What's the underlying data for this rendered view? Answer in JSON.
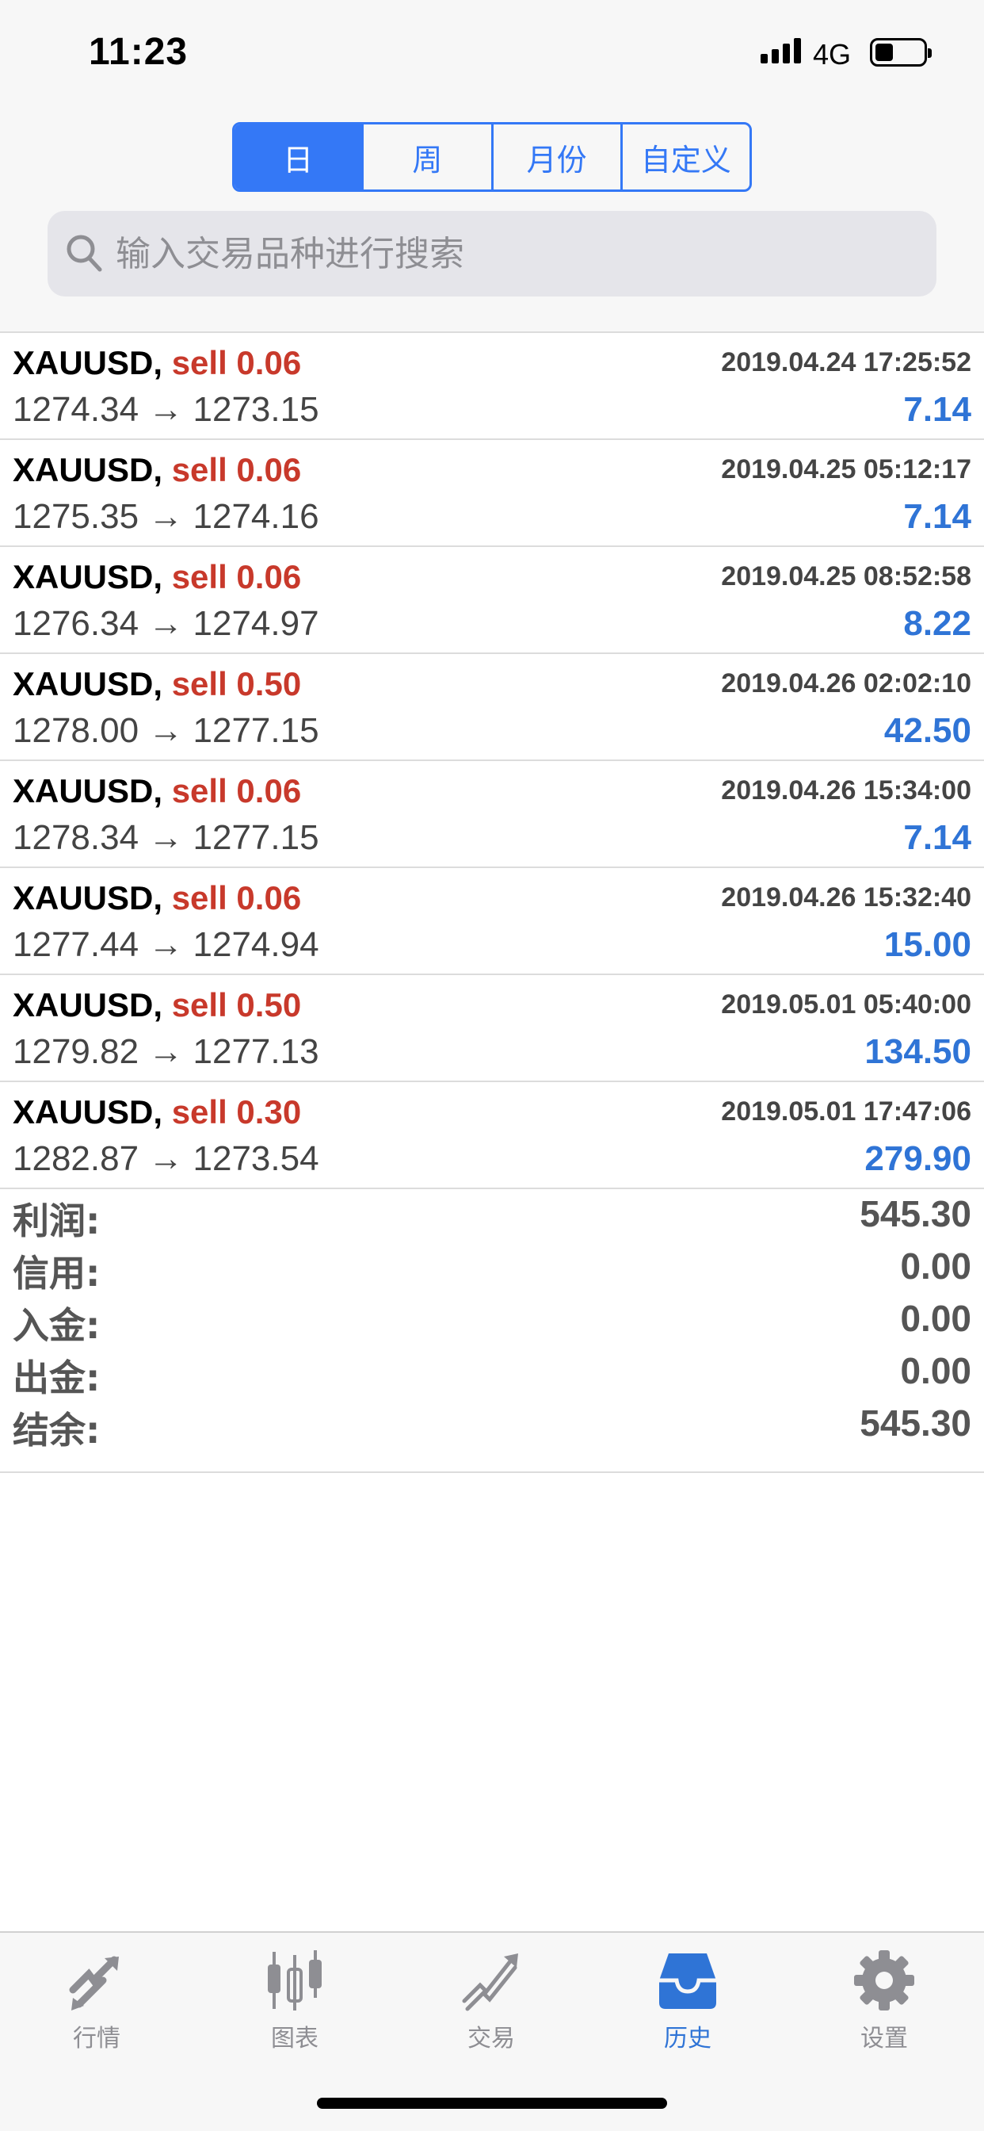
{
  "status": {
    "time": "11:23",
    "network": "4G"
  },
  "segments": [
    {
      "label": "日",
      "active": true
    },
    {
      "label": "周",
      "active": false
    },
    {
      "label": "月份",
      "active": false
    },
    {
      "label": "自定义",
      "active": false
    }
  ],
  "search": {
    "placeholder": "输入交易品种进行搜索"
  },
  "trades": [
    {
      "symbol": "XAUUSD,",
      "side": "sell 0.06",
      "time": "2019.04.24 17:25:52",
      "prices": "1274.34 → 1273.15",
      "profit": "7.14"
    },
    {
      "symbol": "XAUUSD,",
      "side": "sell 0.06",
      "time": "2019.04.25 05:12:17",
      "prices": "1275.35 → 1274.16",
      "profit": "7.14"
    },
    {
      "symbol": "XAUUSD,",
      "side": "sell 0.06",
      "time": "2019.04.25 08:52:58",
      "prices": "1276.34 → 1274.97",
      "profit": "8.22"
    },
    {
      "symbol": "XAUUSD,",
      "side": "sell 0.50",
      "time": "2019.04.26 02:02:10",
      "prices": "1278.00 → 1277.15",
      "profit": "42.50"
    },
    {
      "symbol": "XAUUSD,",
      "side": "sell 0.06",
      "time": "2019.04.26 15:34:00",
      "prices": "1278.34 → 1277.15",
      "profit": "7.14"
    },
    {
      "symbol": "XAUUSD,",
      "side": "sell 0.06",
      "time": "2019.04.26 15:32:40",
      "prices": "1277.44 → 1274.94",
      "profit": "15.00"
    },
    {
      "symbol": "XAUUSD,",
      "side": "sell 0.50",
      "time": "2019.05.01 05:40:00",
      "prices": "1279.82 → 1277.13",
      "profit": "134.50"
    },
    {
      "symbol": "XAUUSD,",
      "side": "sell 0.30",
      "time": "2019.05.01 17:47:06",
      "prices": "1282.87 → 1273.54",
      "profit": "279.90"
    }
  ],
  "summary": [
    {
      "label": "利润:",
      "value": "545.30"
    },
    {
      "label": "信用:",
      "value": "0.00"
    },
    {
      "label": "入金:",
      "value": "0.00"
    },
    {
      "label": "出金:",
      "value": "0.00"
    },
    {
      "label": "结余:",
      "value": "545.30"
    }
  ],
  "tabs": [
    {
      "label": "行情",
      "icon": "quotes-icon",
      "active": false
    },
    {
      "label": "图表",
      "icon": "chart-icon",
      "active": false
    },
    {
      "label": "交易",
      "icon": "trade-icon",
      "active": false
    },
    {
      "label": "历史",
      "icon": "history-icon",
      "active": true
    },
    {
      "label": "设置",
      "icon": "settings-icon",
      "active": false
    }
  ],
  "colors": {
    "accent": "#3478f6",
    "sell": "#c8392b",
    "profit": "#2f74d6"
  }
}
